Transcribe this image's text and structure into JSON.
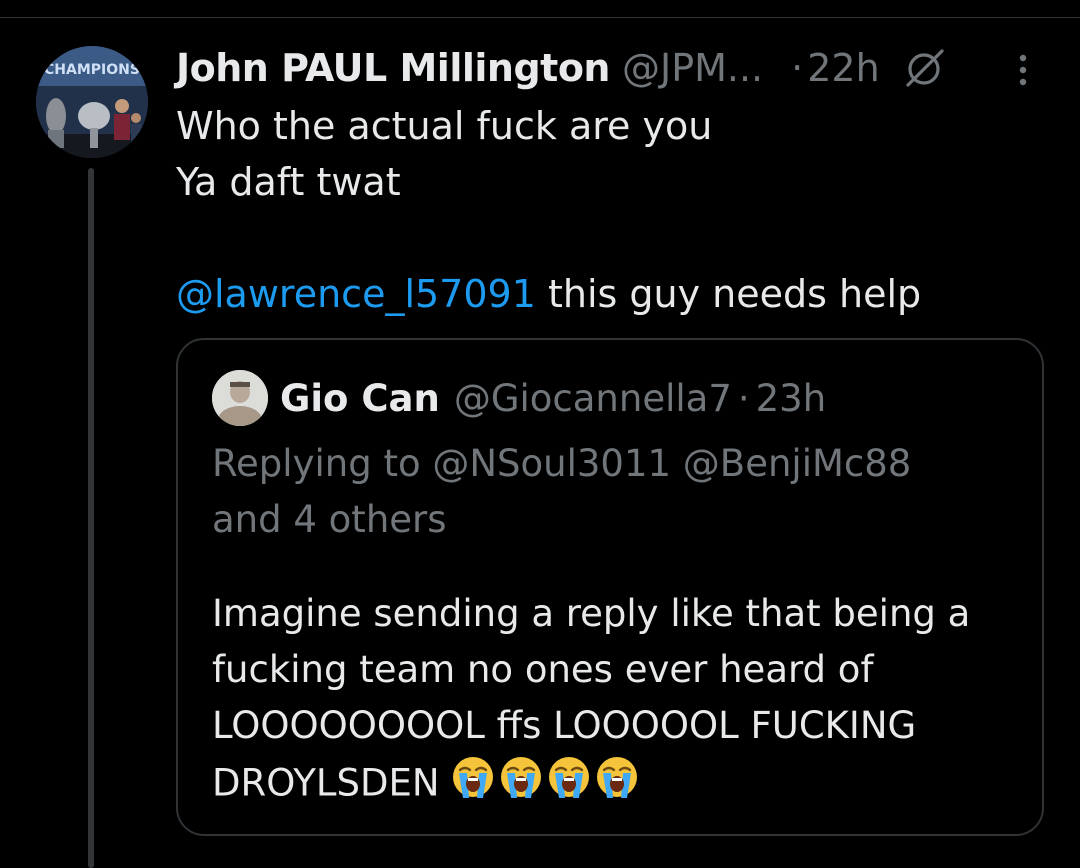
{
  "tweet": {
    "display_name": "John PAUL Millington",
    "handle": "@JPM...",
    "separator": "·",
    "time": "22h",
    "text_line1": "Who the actual fuck are you",
    "text_line2": "Ya daft twat",
    "mention": "@lawrence_l57091",
    "mention_rest": " this guy needs help",
    "avatar_banner_text": "CHAMPIONS"
  },
  "quote": {
    "display_name": "Gio Can",
    "handle": "@Giocannella7",
    "separator": "·",
    "time": "23h",
    "replying_line1": "Replying to @NSoul3011 @BenjiMc88",
    "replying_line2": "and 4 others",
    "body_line1": "Imagine sending a reply like that being a",
    "body_line2": "fucking team no ones ever heard of",
    "body_line3": "LOOOOOOOOL ffs LOOOOOL FUCKING",
    "body_line4": "DROYLSDEN",
    "emoji_count": 4,
    "emoji_name": "loudly-crying-face-emoji"
  },
  "colors": {
    "background": "#000000",
    "text_primary": "#e7e9ea",
    "text_secondary": "#71767b",
    "mention_blue": "#1d9bf0",
    "border": "#2f3336"
  },
  "icons": {
    "edited": "slash-circle-icon",
    "more": "more-vertical-icon"
  }
}
